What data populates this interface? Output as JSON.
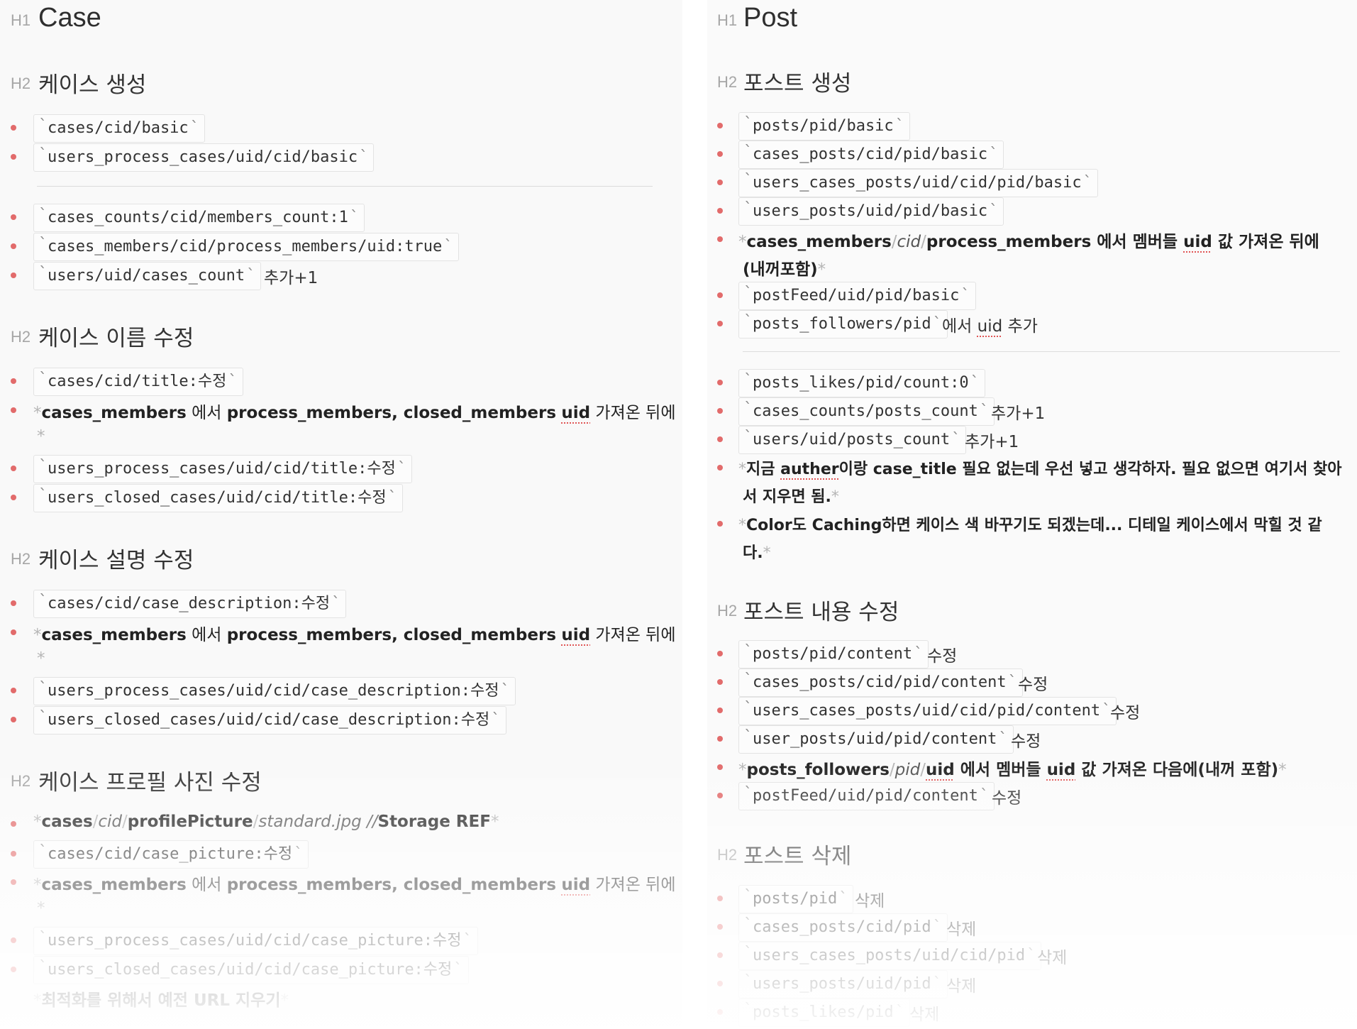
{
  "left": {
    "h1": {
      "marker": "H1",
      "title": "Case"
    },
    "s1": {
      "marker": "H2",
      "title": "케이스 생성",
      "items": [
        "cases/cid/basic",
        "users_process_cases/uid/cid/basic"
      ]
    },
    "s1b": {
      "items": [
        "cases_counts/cid/members_count:1",
        "cases_members/cid/process_members/uid:true",
        "users/uid/cases_count"
      ],
      "tail": "추가+1"
    },
    "s2": {
      "marker": "H2",
      "title": "케이스 이름 수정",
      "i1": "cases/cid/title:수정",
      "note": {
        "a": "cases_members",
        "b": " 에서 ",
        "c": "process_members, closed_members",
        "d": "uid",
        "e": " 가져온 뒤에"
      },
      "i2": "users_process_cases/uid/cid/title:수정",
      "i3": "users_closed_cases/uid/cid/title:수정"
    },
    "s3": {
      "marker": "H2",
      "title": "케이스 설명 수정",
      "i1": "cases/cid/case_description:수정",
      "note": {
        "a": "cases_members",
        "b": " 에서 ",
        "c": "process_members, closed_members",
        "d": "uid",
        "e": " 가져온 뒤에"
      },
      "i2": "users_process_cases/uid/cid/case_description:수정",
      "i3": "users_closed_cases/uid/cid/case_description:수정"
    },
    "s4": {
      "marker": "H2",
      "title": "케이스 프로필 사진 수정",
      "ref": {
        "a": "cases",
        "s1": "/",
        "b": "cid",
        "s2": "/",
        "c": "profilePicture",
        "s3": "/",
        "d": "standard.jpg //",
        "e": "Storage REF"
      },
      "i1": "cases/cid/case_picture:수정",
      "note": {
        "a": "cases_members",
        "b": " 에서 ",
        "c": "process_members, closed_members",
        "d": "uid",
        "e": " 가져온 뒤에"
      },
      "i2": "users_process_cases/uid/cid/case_picture:수정",
      "i3": "users_closed_cases/uid/cid/case_picture:수정",
      "last": "최적화를 위해서 예전 URL 지우기"
    }
  },
  "right": {
    "h1": {
      "marker": "H1",
      "title": "Post"
    },
    "s1": {
      "marker": "H2",
      "title": "포스트 생성",
      "items": [
        "posts/pid/basic",
        "cases_posts/cid/pid/basic",
        "users_cases_posts/uid/cid/pid/basic",
        "users_posts/uid/pid/basic"
      ],
      "note": {
        "a": "cases_members",
        "s1": "/",
        "b": "cid",
        "s2": "/",
        "c": "process_members",
        "d": " 에서 멤버들 ",
        "e": "uid",
        "f": " 값 가져온 뒤에",
        "g": "(내꺼포함)"
      },
      "feed": "postFeed/uid/pid/basic",
      "followers": "posts_followers/pid",
      "followers_tail_a": "에서 ",
      "followers_tail_b": "uid",
      "followers_tail_c": " 추가"
    },
    "s1b": {
      "likes": "posts_likes/pid/count:0",
      "counts": "cases_counts/posts_count",
      "counts_tail": "추가+1",
      "uposts": "users/uid/posts_count",
      "uposts_tail": "추가+1",
      "note1a": "지금 ",
      "note1b": "auther",
      "note1c": "이랑 ",
      "note1d": "case_title",
      "note1e": " 필요 없는데 우선 넣고 생각하자. 필요 없으면 여기서 찾아",
      "note1f": "서 지우면 됨.",
      "note2a": "Color",
      "note2b": "도 ",
      "note2c": "Caching",
      "note2d": "하면 케이스 색 바꾸기도 되겠는데... 디테일 케이스에서 막힐 것 같",
      "note2e": "다."
    },
    "s2": {
      "marker": "H2",
      "title": "포스트 내용 수정",
      "items": [
        "posts/pid/content",
        "cases_posts/cid/pid/content",
        "users_cases_posts/uid/cid/pid/content",
        "user_posts/uid/pid/content"
      ],
      "tail": "수정",
      "note": {
        "a": "posts_followers",
        "s1": "/",
        "b": "pid",
        "s2": "/",
        "c": "uid",
        "d": "  에서 멤버들 ",
        "e": "uid",
        "f": " 값 가져온 다음에(내꺼 포함)"
      },
      "feed": "postFeed/uid/pid/content"
    },
    "s3": {
      "marker": "H2",
      "title": "포스트 삭제",
      "items": [
        "posts/pid",
        "cases_posts/cid/pid",
        "users_cases_posts/uid/cid/pid",
        "users_posts/uid/pid",
        "posts_likes/pid"
      ],
      "tail": "삭제"
    }
  }
}
